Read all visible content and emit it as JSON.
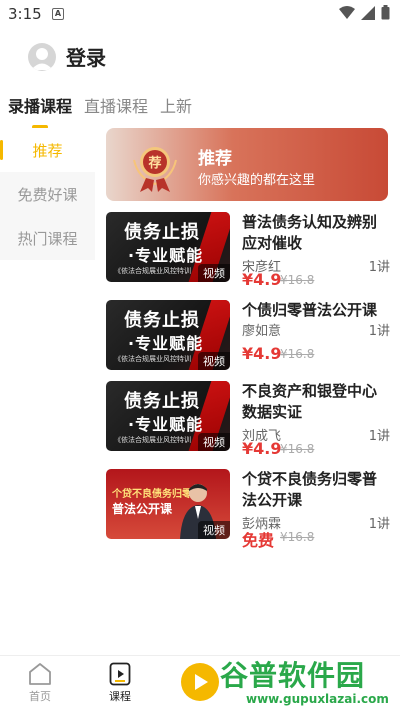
{
  "status": {
    "time": "3:15",
    "notif": "A"
  },
  "header": {
    "login_label": "登录"
  },
  "tabs": [
    {
      "label": "录播课程",
      "active": true
    },
    {
      "label": "直播课程",
      "active": false
    },
    {
      "label": "上新",
      "active": false
    }
  ],
  "sidebar": {
    "items": [
      {
        "label": "推荐",
        "active": true
      },
      {
        "label": "免费好课",
        "active": false
      },
      {
        "label": "热门课程",
        "active": false
      }
    ]
  },
  "banner": {
    "medal_text": "荐",
    "title": "推荐",
    "subtitle": "你感兴趣的都在这里"
  },
  "courses": [
    {
      "thumb": {
        "line1": "债务止损",
        "line2": "·专业赋能",
        "line3": "《依法合规展业风控特训",
        "badge": "视频"
      },
      "title": "普法债务认知及辨别应对催收",
      "teacher": "宋彦红",
      "count": "1讲",
      "price": "¥4.9",
      "original": "¥16.8"
    },
    {
      "thumb": {
        "line1": "债务止损",
        "line2": "·专业赋能",
        "line3": "《依法合规展业风控特训",
        "badge": "视频"
      },
      "title": "个债归零普法公开课",
      "teacher": "廖如意",
      "count": "1讲",
      "price": "¥4.9",
      "original": "¥16.8"
    },
    {
      "thumb": {
        "line1": "债务止损",
        "line2": "·专业赋能",
        "line3": "《依法合规展业风控特训",
        "badge": "视频"
      },
      "title": "不良资产和银登中心数据实证",
      "teacher": "刘成飞",
      "count": "1讲",
      "price": "¥4.9",
      "original": "¥16.8"
    },
    {
      "thumb": {
        "line_a": "个贷不良债务归零",
        "line_b": "普法公开课",
        "badge": "视频"
      },
      "title": "个贷不良债务归零普法公开课",
      "teacher": "彭炳霖",
      "count": "1讲",
      "price": "免费",
      "original": "¥16.8"
    }
  ],
  "bottom_nav": [
    {
      "label": "首页",
      "icon": "home-icon",
      "active": false
    },
    {
      "label": "课程",
      "icon": "course-icon",
      "active": true
    },
    {
      "label": "",
      "icon": "play-icon",
      "active": false
    }
  ],
  "watermark": {
    "title": "谷普软件园",
    "url": "www.gupuxlazai.com"
  },
  "colors": {
    "accent": "#f5b800",
    "price": "#e53935",
    "banner_red": "#c84a36"
  }
}
